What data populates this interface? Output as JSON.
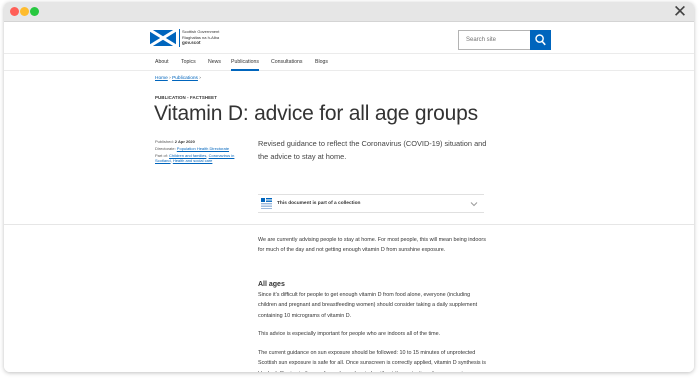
{
  "window": {
    "close_label": "✕"
  },
  "header": {
    "logo_line1": "Scottish Government",
    "logo_line2": "Riaghaltas na h-Alba",
    "logo_line3": "gov.scot",
    "search_placeholder": "Search site"
  },
  "nav": {
    "items": [
      {
        "label": "About"
      },
      {
        "label": "Topics"
      },
      {
        "label": "News"
      },
      {
        "label": "Publications"
      },
      {
        "label": "Consultations"
      },
      {
        "label": "Blogs"
      }
    ]
  },
  "breadcrumb": {
    "home": "Home",
    "sep1": " › ",
    "publications": "Publications",
    "sep2": " ›"
  },
  "publication": {
    "type_label": "PUBLICATION - FACTSHEET",
    "title": "Vitamin D: advice for all age groups",
    "published_label": "Published: ",
    "published_date": "2 Apr 2020",
    "directorate_label": "Directorate: ",
    "directorate": "Population Health Directorate",
    "part_of_label": "Part of: ",
    "part_of_1": "Children and families",
    "part_of_sep1": ", ",
    "part_of_2": "Coronavirus in Scotland",
    "part_of_sep2": ", ",
    "part_of_3": "Health and social care",
    "summary": "Revised guidance to reflect the Coronavirus (COVID-19) situation and the advice to stay at home.",
    "collection_label": "This document is part of a collection"
  },
  "content": {
    "p1": "We are currently advising people to stay at home. For most people, this will mean being indoors for much of the day and not getting enough vitamin D from sunshine exposure.",
    "heading_all_ages": "All ages",
    "p2": "Since it's difficult for people to get enough vitamin D from food alone, everyone (including children and pregnant and breastfeeding women) should consider taking a daily supplement containing 10 micrograms of vitamin D.",
    "p3": "This advice is especially important for people who are indoors all of the time.",
    "p4": "The current guidance on sun exposure should be followed: 10 to 15 minutes of unprotected Scottish sun exposure is safe for all. Once sunscreen is correctly applied, vitamin D synthesis is blocked. Staying in the sun for prolonged periods without the protection of sunscreen increases the risk of skin cancer."
  },
  "colors": {
    "brand_blue": "#0065bd",
    "window_close_red": "#ff5f57",
    "window_min_yellow": "#febc2e",
    "window_max_green": "#28c840"
  }
}
